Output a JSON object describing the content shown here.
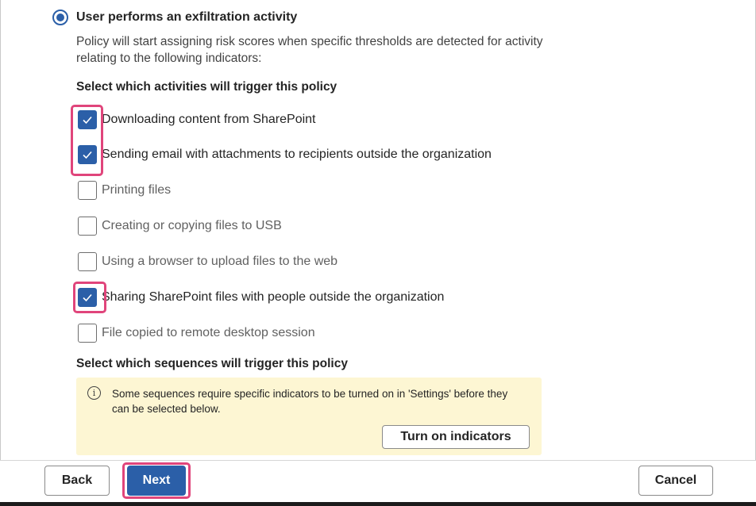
{
  "policy_option": {
    "label": "User performs an exfiltration activity",
    "selected": true,
    "description": "Policy will start assigning risk scores when specific thresholds are detected for activity relating to the following indicators:"
  },
  "activities": {
    "title": "Select which activities will trigger this policy",
    "items": [
      {
        "label": "Downloading content from SharePoint",
        "checked": true
      },
      {
        "label": "Sending email with attachments to recipients outside the organization",
        "checked": true
      },
      {
        "label": "Printing files",
        "checked": false
      },
      {
        "label": "Creating or copying files to USB",
        "checked": false
      },
      {
        "label": "Using a browser to upload files to the web",
        "checked": false
      },
      {
        "label": "Sharing SharePoint files with people outside the organization",
        "checked": true
      },
      {
        "label": "File copied to remote desktop session",
        "checked": false
      }
    ]
  },
  "sequences": {
    "title": "Select which sequences will trigger this policy",
    "notice_icon": "info-icon",
    "notice_text": "Some sequences require specific indicators to be turned on in 'Settings' before they can be selected below.",
    "turn_on_label": "Turn on indicators"
  },
  "footer": {
    "back_label": "Back",
    "next_label": "Next",
    "cancel_label": "Cancel"
  },
  "colors": {
    "accent": "#2b5fa8",
    "highlight": "#e0457b",
    "notice_bg": "#fdf6d3"
  }
}
